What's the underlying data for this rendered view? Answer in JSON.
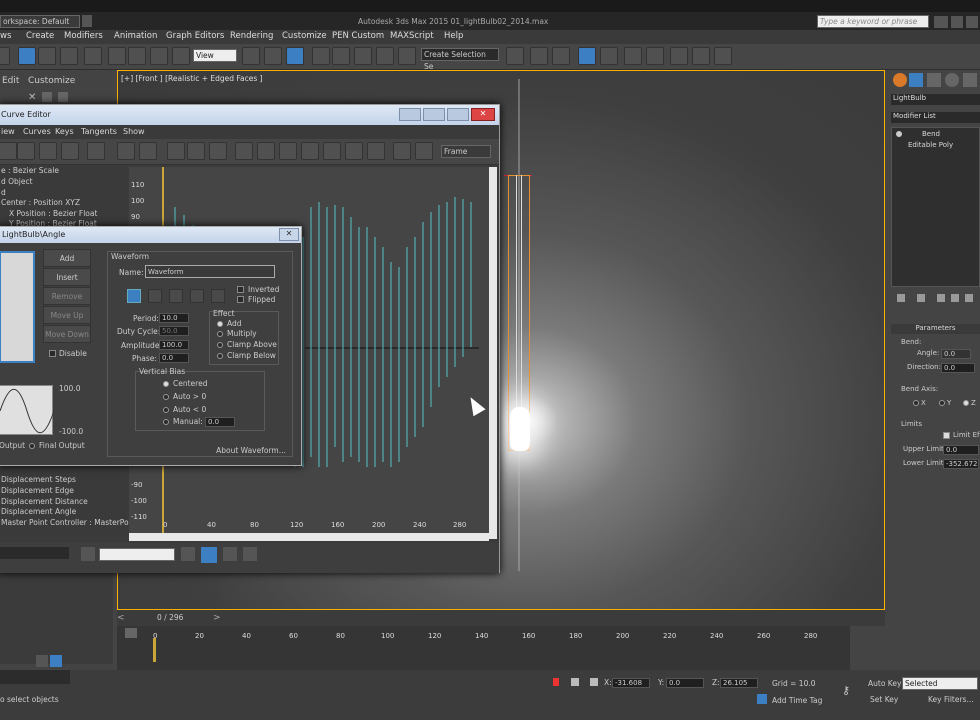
{
  "app": {
    "workspace": "orkspace: Default",
    "title": "Autodesk 3ds Max  2015     01_lightBulb02_2014.max",
    "search_placeholder": "Type a keyword or phrase"
  },
  "menus": [
    "ws",
    "Create",
    "Modifiers",
    "Animation",
    "Graph Editors",
    "Rendering",
    "Customize",
    "PEN Custom",
    "MAXScript",
    "Help"
  ],
  "toolbar": {
    "view_combo": "View",
    "selection_set": "Create Selection Se"
  },
  "left_menu": {
    "edit": "Edit",
    "customize": "Customize"
  },
  "viewport": {
    "label": "[+] [Front ] [Realistic + Edged Faces ]"
  },
  "curve_editor": {
    "title": "Curve Editor",
    "menu": [
      "iew",
      "Curves",
      "Keys",
      "Tangents",
      "Show"
    ],
    "frame_label": "Frame",
    "tree": [
      "e : Bezier Scale",
      "d Object",
      "d",
      "Center : Position XYZ",
      "X Position : Bezier Float",
      "Y Position : Bezier Float"
    ],
    "tree_bottom": [
      "Displacement Steps",
      "Displacement Edge",
      "Displacement Distance",
      "Displacement Angle",
      "Master Point Controller : MasterPoin"
    ],
    "y_ticks": [
      "110",
      "100",
      "90",
      "-90",
      "-100",
      "-110"
    ],
    "x_ticks": [
      "0",
      "40",
      "80",
      "120",
      "160",
      "200",
      "240",
      "280"
    ]
  },
  "waveform": {
    "title": "LightBulb\\Angle",
    "buttons": {
      "add": "Add",
      "insert": "Insert",
      "remove": "Remove",
      "move_up": "Move Up",
      "move_down": "Move Down",
      "disable": "Disable"
    },
    "preview_max": "100.0",
    "preview_min": "-100.0",
    "output": {
      "output": "Output",
      "final": "Final Output"
    },
    "group": "Waveform",
    "name_label": "Name:",
    "name_value": "Waveform",
    "inverted": "Inverted",
    "flipped": "Flipped",
    "period": {
      "label": "Period:",
      "value": "10.0"
    },
    "duty": {
      "label": "Duty Cycle:",
      "value": "50.0"
    },
    "amplitude": {
      "label": "Amplitude:",
      "value": "100.0"
    },
    "phase": {
      "label": "Phase:",
      "value": "0.0"
    },
    "effect": {
      "title": "Effect",
      "add": "Add",
      "multiply": "Multiply",
      "clamp_above": "Clamp Above",
      "clamp_below": "Clamp Below"
    },
    "bias": {
      "title": "Vertical Bias",
      "centered": "Centered",
      "auto_pos": "Auto > 0",
      "auto_neg": "Auto < 0",
      "manual": "Manual:",
      "manual_value": "0.0"
    },
    "about": "About Waveform..."
  },
  "command_panel": {
    "object_name": "LightBulb",
    "modifier_list": "Modifier List",
    "stack": [
      "Bend",
      "Editable Poly"
    ],
    "rollout": "Parameters",
    "bend": "Bend:",
    "angle": {
      "label": "Angle:",
      "value": "0.0"
    },
    "direction": {
      "label": "Direction:",
      "value": "0.0"
    },
    "axis": {
      "label": "Bend Axis:",
      "x": "X",
      "y": "Y",
      "z": "Z"
    },
    "limits": "Limits",
    "limit_effect": "Limit Eff",
    "upper": {
      "label": "Upper Limit:",
      "value": "0.0"
    },
    "lower": {
      "label": "Lower Limit:",
      "value": "-352.672"
    }
  },
  "timeline": {
    "frame": "0 / 296",
    "ticks": [
      "0",
      "20",
      "40",
      "60",
      "80",
      "100",
      "120",
      "140",
      "160",
      "180",
      "200",
      "220",
      "240",
      "260",
      "280"
    ]
  },
  "status": {
    "prompt": "o select objects",
    "x": "-31.608",
    "y": "0.0",
    "z": "26.105",
    "grid": "Grid = 10.0",
    "add_time_tag": "Add Time Tag",
    "auto_key": "Auto Key",
    "selected": "Selected",
    "set_key": "Set Key",
    "key_filters": "Key Filters..."
  }
}
